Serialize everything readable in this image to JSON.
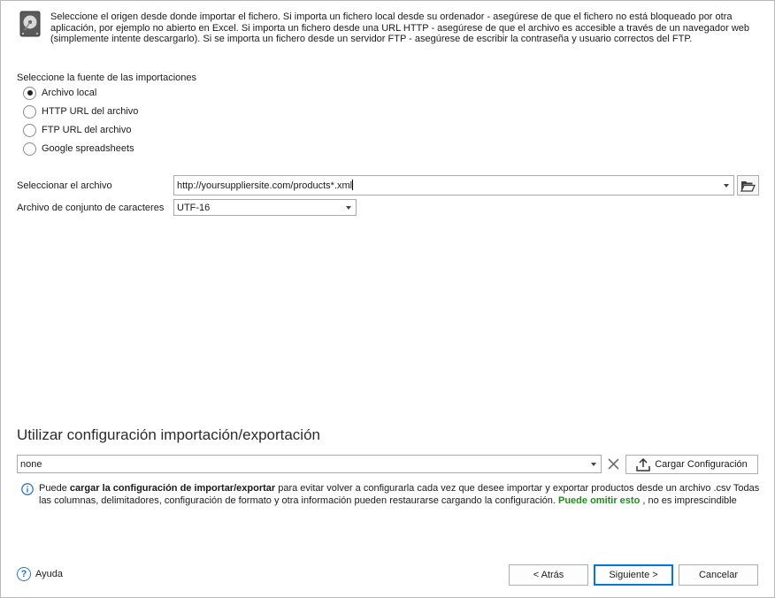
{
  "header": {
    "icon": "hard-drive-icon",
    "description": "Seleccione el origen desde donde importar el fichero. Si importa un fichero local desde su ordenador - asegúrese de que el fichero no está bloqueado por otra aplicación, por ejemplo no abierto en Excel. Si importa un fichero desde una URL HTTP - asegúrese de que el archivo es accesible a través de un navegador web (simplemente intente descargarlo). Si se importa un fichero desde un servidor FTP - asegúrese de escribir la contraseña y usuario correctos del FTP."
  },
  "source": {
    "label": "Seleccione la fuente de las importaciones",
    "options": [
      {
        "label": "Archivo local",
        "checked": true
      },
      {
        "label": "HTTP URL del archivo",
        "checked": false
      },
      {
        "label": "FTP URL del archivo",
        "checked": false
      },
      {
        "label": "Google spreadsheets",
        "checked": false
      }
    ]
  },
  "file": {
    "label": "Seleccionar el archivo",
    "value": "http://yoursuppliersite.com/products*.xml",
    "browse_icon": "folder-open-icon"
  },
  "charset": {
    "label": "Archivo de conjunto de caracteres",
    "value": "UTF-16"
  },
  "config": {
    "title": "Utilizar configuración importación/exportación",
    "value": "none",
    "clear_icon": "close-icon",
    "load_label": "Cargar Configuración",
    "load_icon": "upload-icon",
    "info_prefix": "Puede ",
    "info_bold": "cargar la configuración de importar/exportar",
    "info_middle": " para evitar volver a configurarla cada vez que desee importar y exportar productos desde un archivo .csv Todas las columnas, delimitadores, configuración de formato y otra información pueden restaurarse cargando la configuración. ",
    "info_green": "Puede omitir esto",
    "info_suffix": " , no es imprescindible",
    "accent_green": "#1e8c1e"
  },
  "footer": {
    "help_label": "Ayuda",
    "back_label": "< Atrás",
    "next_label": "Siguiente >",
    "cancel_label": "Cancelar"
  }
}
